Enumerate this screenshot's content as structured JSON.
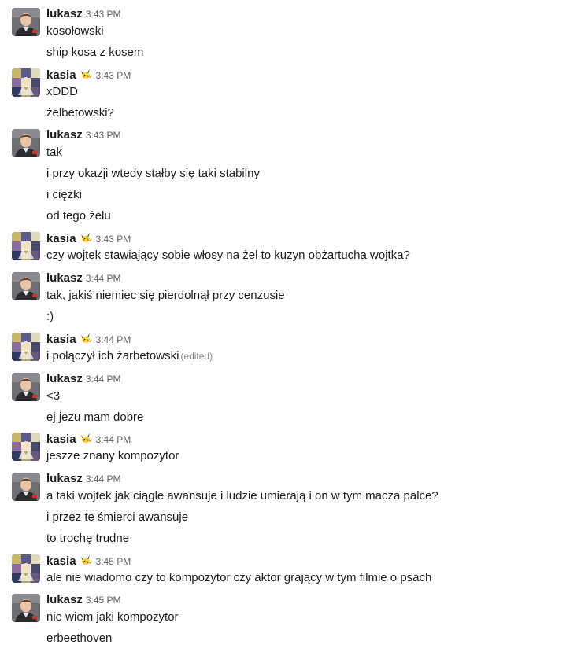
{
  "users": {
    "lukasz": {
      "name": "lukasz"
    },
    "kasia": {
      "name": "kasia",
      "badge_icon": "pikachu-emoji-icon"
    }
  },
  "groups": [
    {
      "user": "lukasz",
      "time": "3:43 PM",
      "lines": [
        "kosołowski",
        "ship kosa z kosem"
      ]
    },
    {
      "user": "kasia",
      "time": "3:43 PM",
      "lines": [
        "xDDD",
        "żelbetowski?"
      ]
    },
    {
      "user": "lukasz",
      "time": "3:43 PM",
      "lines": [
        "tak",
        "i przy okazji wtedy stałby się taki stabilny",
        "i ciężki",
        "od tego żelu"
      ]
    },
    {
      "user": "kasia",
      "time": "3:43 PM",
      "lines": [
        "czy wojtek stawiający sobie włosy na żel to kuzyn obżartucha wojtka?"
      ]
    },
    {
      "user": "lukasz",
      "time": "3:44 PM",
      "lines": [
        "tak, jakiś niemiec się pierdolnął przy cenzusie",
        ":)"
      ]
    },
    {
      "user": "kasia",
      "time": "3:44 PM",
      "lines": [
        "i połączył ich żarbetowski"
      ],
      "edited": "(edited)"
    },
    {
      "user": "lukasz",
      "time": "3:44 PM",
      "lines": [
        "<3",
        "ej jezu mam dobre"
      ]
    },
    {
      "user": "kasia",
      "time": "3:44 PM",
      "lines": [
        "jeszze znany kompozytor"
      ]
    },
    {
      "user": "lukasz",
      "time": "3:44 PM",
      "lines": [
        "a taki wojtek jak ciągle awansuje i ludzie umierają i on w tym macza palce?",
        "i przez te śmierci awansuje",
        "to trochę trudne"
      ]
    },
    {
      "user": "kasia",
      "time": "3:45 PM",
      "lines": [
        "ale nie wiadomo czy to kompozytor czy aktor grający w tym filmie o psach"
      ]
    },
    {
      "user": "lukasz",
      "time": "3:45 PM",
      "lines": [
        "nie wiem jaki kompozytor",
        "erbeethoven"
      ]
    }
  ],
  "colors": {
    "text": "#1d1c1d",
    "timestamp": "#616061",
    "edited": "#868686",
    "background": "#ffffff"
  }
}
